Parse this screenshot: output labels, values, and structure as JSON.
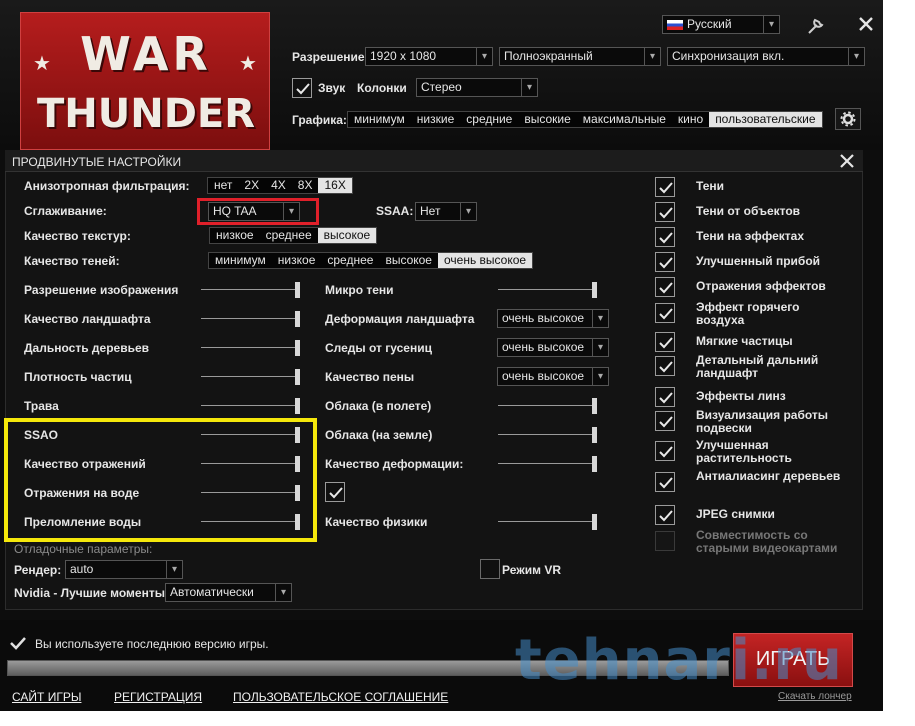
{
  "header": {
    "logo": {
      "line1": "WAR",
      "line2": "THUNDER"
    },
    "language": "Русский",
    "resolution_label": "Разрешение",
    "resolution_value": "1920 x 1080",
    "window_mode": "Полноэкранный",
    "vsync": "Синхронизация вкл.",
    "sound_label": "Звук",
    "speakers_label": "Колонки",
    "speakers_value": "Стерео",
    "graphics_label": "Графика:",
    "graphics_presets": [
      "минимум",
      "низкие",
      "средние",
      "высокие",
      "максимальные",
      "кино",
      "пользовательские"
    ],
    "graphics_selected": 6
  },
  "advanced": {
    "title": "ПРОДВИНУТЫЕ НАСТРОЙКИ",
    "anisotropy_label": "Анизотропная фильтрация:",
    "anisotropy_options": [
      "нет",
      "2X",
      "4X",
      "8X",
      "16X"
    ],
    "anisotropy_selected": 4,
    "antialiasing_label": "Сглаживание:",
    "antialiasing_value": "HQ TAA",
    "ssaa_label": "SSAA:",
    "ssaa_value": "Нет",
    "texture_label": "Качество текстур:",
    "texture_options": [
      "низкое",
      "среднее",
      "высокое"
    ],
    "texture_selected": 2,
    "shadow_label": "Качество теней:",
    "shadow_options": [
      "минимум",
      "низкое",
      "среднее",
      "высокое",
      "очень высокое"
    ],
    "shadow_selected": 4,
    "left_sliders": [
      {
        "label": "Разрешение изображения",
        "value": 1.0
      },
      {
        "label": "Качество ландшафта",
        "value": 1.0
      },
      {
        "label": "Дальность деревьев",
        "value": 1.0
      },
      {
        "label": "Плотность частиц",
        "value": 1.0
      },
      {
        "label": "Трава",
        "value": 1.0
      },
      {
        "label": "SSAO",
        "value": 1.0
      },
      {
        "label": "Качество отражений",
        "value": 1.0
      },
      {
        "label": "Отражения на воде",
        "value": 1.0
      },
      {
        "label": "Преломление воды",
        "value": 1.0
      }
    ],
    "mid_items": [
      {
        "label": "Микро тени",
        "kind": "slider",
        "value": 1.0
      },
      {
        "label": "Деформация ландшафта",
        "kind": "select",
        "value": "очень высокое"
      },
      {
        "label": "Следы от гусениц",
        "kind": "select",
        "value": "очень высокое"
      },
      {
        "label": "Качество пены",
        "kind": "select",
        "value": "очень высокое"
      },
      {
        "label": "Облака (в полете)",
        "kind": "slider",
        "value": 1.0
      },
      {
        "label": "Облака (на земле)",
        "kind": "slider",
        "value": 1.0
      },
      {
        "label": "Качество деформации:",
        "kind": "slider",
        "value": 1.0
      },
      {
        "label": "",
        "kind": "checkbox",
        "value": true
      },
      {
        "label": "Качество физики",
        "kind": "slider",
        "value": 1.0
      }
    ],
    "right_checks": [
      {
        "label": "Тени",
        "checked": true
      },
      {
        "label": "Тени от объектов",
        "checked": true
      },
      {
        "label": "Тени на эффектах",
        "checked": true
      },
      {
        "label": "Улучшенный прибой",
        "checked": true
      },
      {
        "label": "Отражения эффектов",
        "checked": true
      },
      {
        "label": "Эффект горячего воздуха",
        "checked": true
      },
      {
        "label": "Мягкие частицы",
        "checked": true
      },
      {
        "label": "Детальный дальний ландшафт",
        "checked": true
      },
      {
        "label": "Эффекты линз",
        "checked": true
      },
      {
        "label": "Визуализация работы подвески",
        "checked": true
      },
      {
        "label": "Улучшенная растительность",
        "checked": true
      },
      {
        "label": "Антиалиасинг деревьев",
        "checked": true
      },
      {
        "label": "JPEG снимки",
        "checked": true
      },
      {
        "label": "Совместимость со старыми видеокартами",
        "checked": false
      }
    ],
    "debug_label": "Отладочные параметры:",
    "render_label": "Рендер:",
    "render_value": "auto",
    "nvidia_label": "Nvidia - Лучшие моменты:",
    "nvidia_value": "Автоматически",
    "vr_label": "Режим VR"
  },
  "status": {
    "message": "Вы используете последнюю версию игры.",
    "progress": 1.0,
    "play_label": "ИГРАТЬ",
    "download_link": "Скачать лончер",
    "watermark": "tehnari.ru"
  },
  "footer": {
    "links": [
      "САЙТ ИГРЫ",
      "РЕГИСТРАЦИЯ",
      "ПОЛЬЗОВАТЕЛЬСКОЕ СОГЛАШЕНИЕ"
    ]
  },
  "colors": {
    "accent_red": "#e0202a",
    "highlight_yellow": "#f5e80b",
    "play_button": "#b41e1e"
  }
}
